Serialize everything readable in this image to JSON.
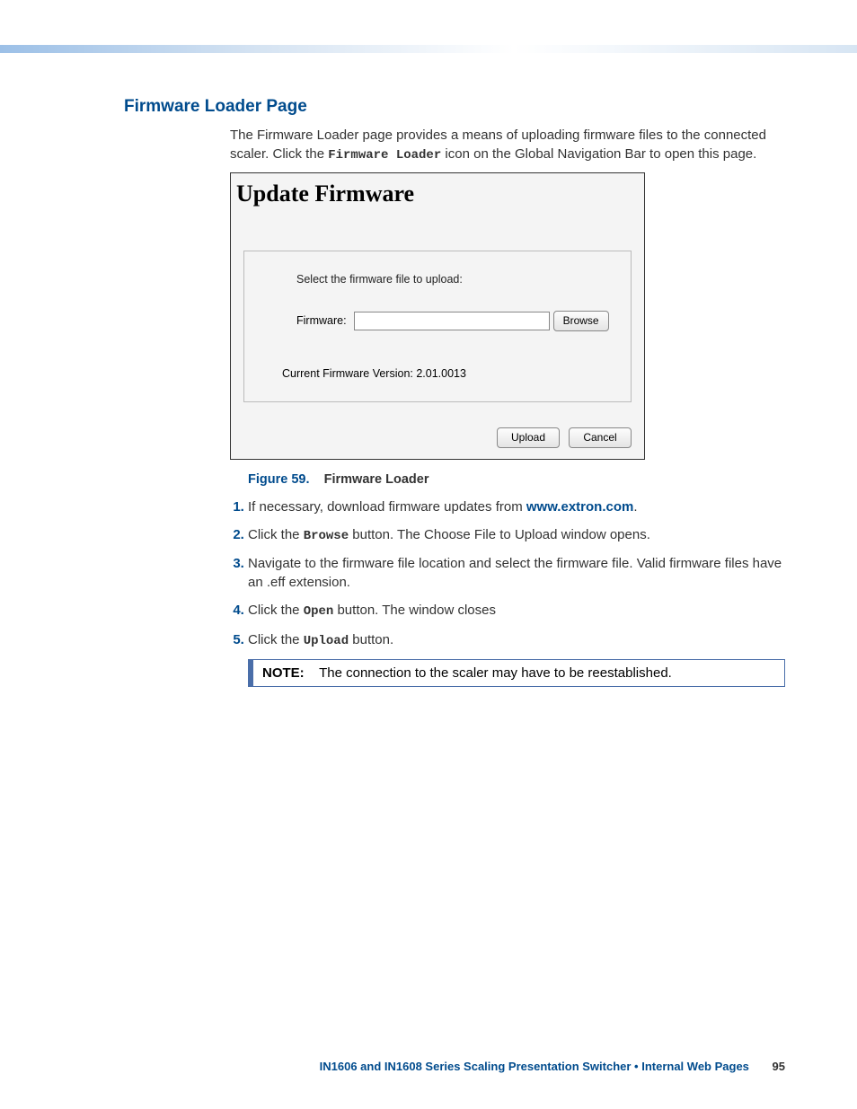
{
  "heading": "Firmware Loader Page",
  "intro_a": "The Firmware Loader page provides a means of uploading firmware files to the connected scaler. Click the ",
  "intro_mono": "Firmware Loader",
  "intro_b": " icon on the Global Navigation Bar to open this page.",
  "screenshot": {
    "title": "Update Firmware",
    "select_label": "Select the firmware file to upload:",
    "field_label": "Firmware:",
    "browse": "Browse",
    "version": "Current Firmware Version: 2.01.0013",
    "upload": "Upload",
    "cancel": "Cancel"
  },
  "figure": {
    "num": "Figure 59.",
    "title": "Firmware Loader"
  },
  "steps": {
    "s1a": "If necessary, download firmware updates from ",
    "s1link": "www.extron.com",
    "s1b": ".",
    "s2a": "Click the ",
    "s2mono": "Browse",
    "s2b": " button. The Choose File to Upload window opens.",
    "s3": "Navigate to the firmware file location and select the firmware file. Valid firmware files have an .eff extension.",
    "s4a": "Click the ",
    "s4mono": "Open",
    "s4b": " button. The window closes",
    "s5a": "Click the ",
    "s5mono": "Upload",
    "s5b": " button."
  },
  "note": {
    "label": "NOTE:",
    "text": "The connection to the scaler may have to be reestablished."
  },
  "footer": {
    "title": "IN1606 and IN1608 Series Scaling Presentation Switcher • Internal Web Pages",
    "page": "95"
  }
}
